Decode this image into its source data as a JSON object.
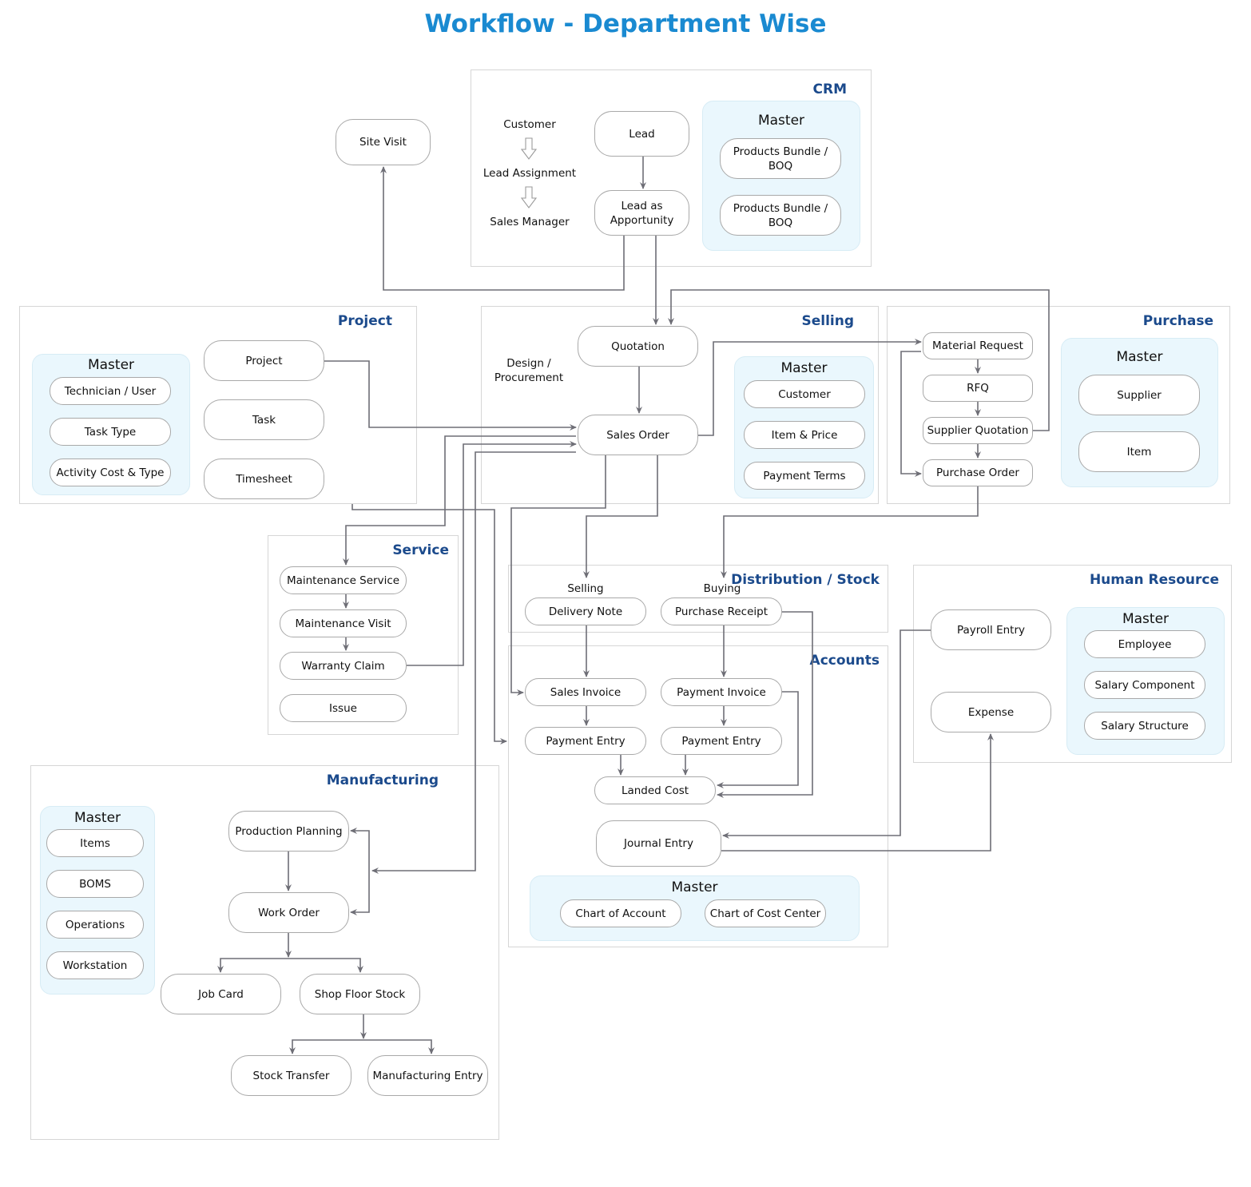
{
  "title": "Workflow - Department Wise",
  "master_label": "Master",
  "crm": {
    "title": "CRM",
    "steps": [
      "Customer",
      "Lead Assignment",
      "Sales Manager"
    ],
    "nodes": {
      "lead": "Lead",
      "lead_opportunity": "Lead as\nApportunity"
    },
    "master_items": [
      "Products Bundle /\nBOQ",
      "Products Bundle /\nBOQ"
    ]
  },
  "site_visit": "Site Visit",
  "project": {
    "title": "Project",
    "master_items": [
      "Technician / User",
      "Task Type",
      "Activity Cost & Type"
    ],
    "nodes": [
      "Project",
      "Task",
      "Timesheet"
    ]
  },
  "selling": {
    "title": "Selling",
    "note": "Design /\nProcurement",
    "nodes": {
      "quotation": "Quotation",
      "sales_order": "Sales Order"
    },
    "master_items": [
      "Customer",
      "Item & Price",
      "Payment Terms"
    ]
  },
  "purchase": {
    "title": "Purchase",
    "nodes": [
      "Material Request",
      "RFQ",
      "Supplier Quotation",
      "Purchase Order"
    ],
    "master_items": [
      "Supplier",
      "Item"
    ]
  },
  "service": {
    "title": "Service",
    "nodes": [
      "Maintenance Service",
      "Maintenance Visit",
      "Warranty Claim",
      "Issue"
    ]
  },
  "distribution": {
    "title": "Distribution / Stock",
    "selling_label": "Selling",
    "buying_label": "Buying",
    "nodes": {
      "delivery_note": "Delivery Note",
      "purchase_receipt": "Purchase Receipt"
    }
  },
  "accounts": {
    "title": "Accounts",
    "nodes": {
      "sales_invoice": "Sales Invoice",
      "payment_invoice": "Payment Invoice",
      "payment_entry_sell": "Payment Entry",
      "payment_entry_buy": "Payment Entry",
      "landed_cost": "Landed Cost",
      "journal_entry": "Journal Entry"
    },
    "master_items": [
      "Chart of Account",
      "Chart of Cost Center"
    ]
  },
  "hr": {
    "title": "Human Resource",
    "nodes": {
      "payroll_entry": "Payroll Entry",
      "expense": "Expense"
    },
    "master_items": [
      "Employee",
      "Salary Component",
      "Salary Structure"
    ]
  },
  "manufacturing": {
    "title": "Manufacturing",
    "master_items": [
      "Items",
      "BOMS",
      "Operations",
      "Workstation"
    ],
    "nodes": {
      "production_planning": "Production Planning",
      "work_order": "Work Order",
      "job_card": "Job Card",
      "shop_floor_stock": "Shop Floor Stock",
      "stock_transfer": "Stock Transfer",
      "manufacturing_entry": "Manufacturing Entry"
    }
  }
}
